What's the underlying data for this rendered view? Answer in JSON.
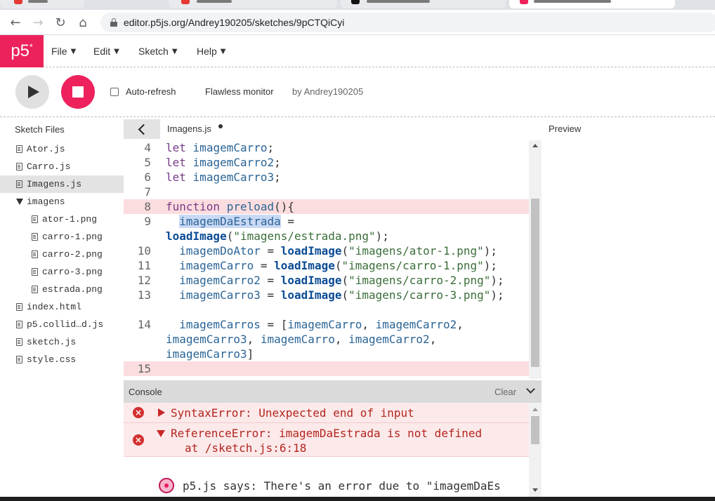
{
  "browser": {
    "url": "editor.p5js.org/Andrey190205/sketches/9pCTQiCyi",
    "back_icon": "arrow-left-icon",
    "forward_icon": "arrow-right-icon",
    "reload_icon": "reload-icon",
    "home_icon": "home-icon"
  },
  "nav": {
    "logo": "p5",
    "logo_sup": "*",
    "menus": [
      "File",
      "Edit",
      "Sketch",
      "Help"
    ]
  },
  "toolbar": {
    "auto_refresh_label": "Auto-refresh",
    "auto_refresh_checked": false,
    "project_name": "Flawless monitor",
    "author": "by Andrey190205"
  },
  "sidebar": {
    "title": "Sketch Files",
    "files": [
      {
        "name": "Ator.js",
        "type": "file",
        "indent": 0
      },
      {
        "name": "Carro.js",
        "type": "file",
        "indent": 0
      },
      {
        "name": "Imagens.js",
        "type": "file",
        "indent": 0,
        "selected": true
      },
      {
        "name": "imagens",
        "type": "folder",
        "indent": 0
      },
      {
        "name": "ator-1.png",
        "type": "file",
        "indent": 1
      },
      {
        "name": "carro-1.png",
        "type": "file",
        "indent": 1
      },
      {
        "name": "carro-2.png",
        "type": "file",
        "indent": 1
      },
      {
        "name": "carro-3.png",
        "type": "file",
        "indent": 1
      },
      {
        "name": "estrada.png",
        "type": "file",
        "indent": 1
      },
      {
        "name": "index.html",
        "type": "file",
        "indent": 0
      },
      {
        "name": "p5.collid…d.js",
        "type": "file",
        "indent": 0
      },
      {
        "name": "sketch.js",
        "type": "file",
        "indent": 0
      },
      {
        "name": "style.css",
        "type": "file",
        "indent": 0
      }
    ]
  },
  "editor": {
    "file_tab": "Imagens.js",
    "unsaved": true,
    "line_numbers": [
      "4",
      "5",
      "6",
      "7",
      "8",
      "9",
      "10",
      "11",
      "12",
      "13",
      "14",
      "15"
    ],
    "error_lines": [
      "8",
      "15"
    ],
    "code": {
      "l4_kw": "let",
      "l4_v": "imagemCarro",
      "l4_p": ";",
      "l5_kw": "let",
      "l5_v": "imagemCarro2",
      "l5_p": ";",
      "l6_kw": "let",
      "l6_v": "imagemCarro3",
      "l6_p": ";",
      "l8_kw": "function",
      "l8_f": "preload",
      "l8_p": "(){",
      "l9_v": "imagemDaEstrada",
      "l9_p": " =",
      "l9b_f": "loadImage",
      "l9b_s": "\"imagens/estrada.png\"",
      "l10_v": "imagemDoAtor",
      "l10_f": "loadImage",
      "l10_s": "\"imagens/ator-1.png\"",
      "l11_v": "imagemCarro",
      "l11_f": "loadImage",
      "l11_s": "\"imagens/carro-1.png\"",
      "l12_v": "imagemCarro2",
      "l12_f": "loadImage",
      "l12_s": "\"imagens/carro-2.png\"",
      "l13_v": "imagemCarro3",
      "l13_f": "loadImage",
      "l13_s": "\"imagens/carro-3.png\"",
      "l14_v": "imagemCarros",
      "l14_a": "imagemCarro",
      "l14_b": "imagemCarro2",
      "l14b_a": "imagemCarro3",
      "l14b_b": "imagemCarro",
      "l14b_c": "imagemCarro2",
      "l14c_a": "imagemCarro3"
    }
  },
  "preview": {
    "title": "Preview"
  },
  "console": {
    "title": "Console",
    "clear_label": "Clear",
    "messages": [
      {
        "text": "SyntaxError: Unexpected end of input",
        "expanded": false
      },
      {
        "text": "ReferenceError: imagemDaEstrada is not defined",
        "detail": "at /sketch.js:6:18",
        "expanded": true
      }
    ],
    "p5_says": "p5.js says: There's an error due to \"imagemDaEs"
  },
  "colors": {
    "accent": "#ed225d",
    "error_bg": "#fce9ea",
    "error_text": "#b3261e",
    "error_line_bg": "#fcdddf"
  }
}
